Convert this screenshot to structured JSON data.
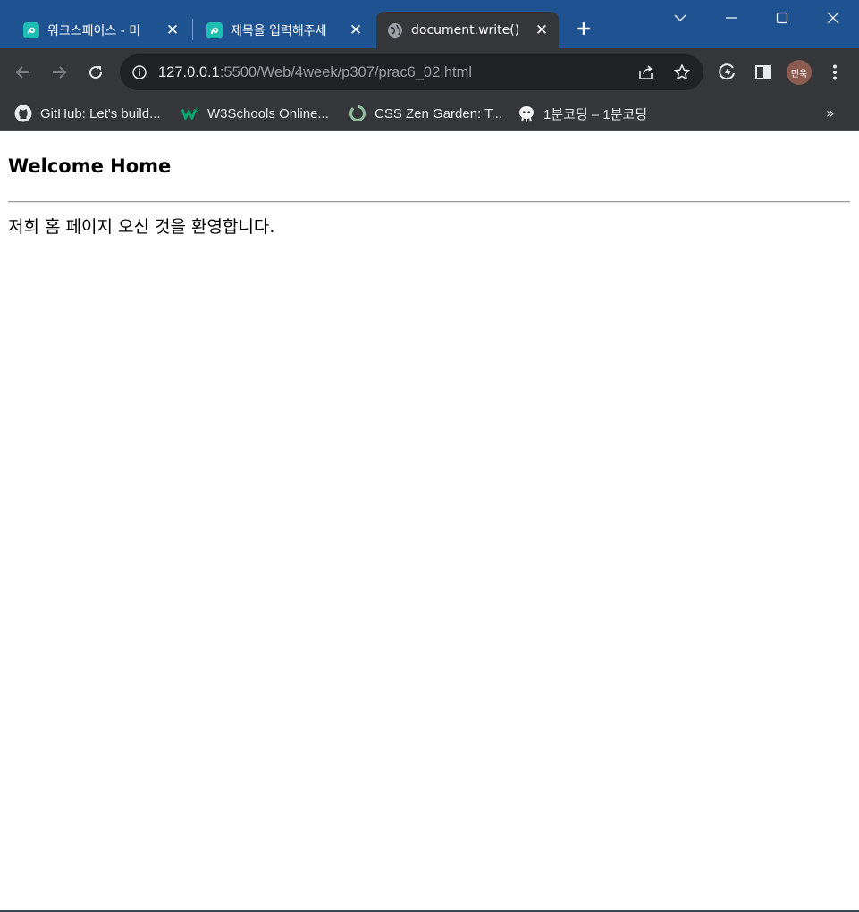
{
  "tabs": [
    {
      "title": "워크스페이스 - 미",
      "favicon": "replit-icon",
      "active": false
    },
    {
      "title": "제목을 입력해주세",
      "favicon": "replit-icon",
      "active": false
    },
    {
      "title": "document.write()",
      "favicon": "globe-icon",
      "active": true
    }
  ],
  "toolbar": {
    "url_host": "127.0.0.1",
    "url_rest": ":5500/Web/4week/p307/prac6_02.html",
    "profile_label": "민욱"
  },
  "bookmarks": [
    {
      "label": "GitHub: Let's build...",
      "icon": "github-icon"
    },
    {
      "label": "W3Schools Online...",
      "icon": "w3schools-icon"
    },
    {
      "label": "CSS Zen Garden: T...",
      "icon": "zen-garden-icon"
    },
    {
      "label": "1분코딩 – 1분코딩",
      "icon": "coding-icon"
    }
  ],
  "bookmarks_overflow": "»",
  "page": {
    "heading": "Welcome Home",
    "paragraph": "저희 홈 페이지 오신 것을 환영합니다."
  },
  "colors": {
    "titlebar": "#1f5290",
    "toolbar": "#35363a",
    "omnibox": "#202124"
  }
}
